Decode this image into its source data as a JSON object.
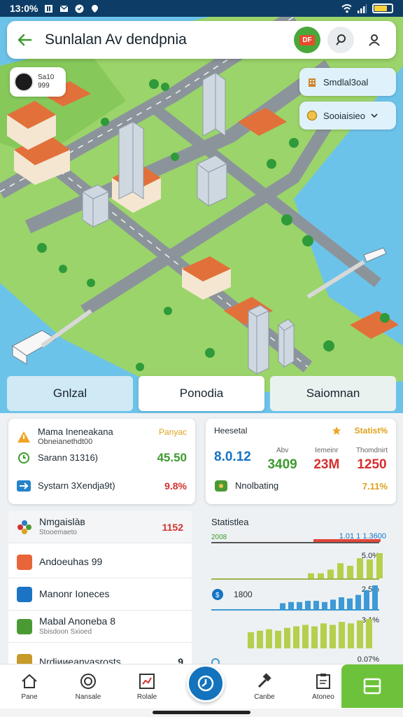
{
  "status_bar": {
    "time": "13:0%"
  },
  "header": {
    "title": "Sunlalan Av dendpnia",
    "flag_badge": "DF"
  },
  "player": {
    "line1": "Sa10",
    "line2": "999"
  },
  "side_pills": [
    {
      "label": "Smdlal3oal"
    },
    {
      "label": "Sooiaisieo"
    }
  ],
  "tabs": [
    {
      "label": "Gnlzal"
    },
    {
      "label": "Ponodia"
    },
    {
      "label": "Saiomnan"
    }
  ],
  "card_a": {
    "rows": [
      {
        "label": "Mama Ineneakana",
        "sub": "Obneianethdt00",
        "value": "Panyac",
        "value_color": "#e0a11b"
      },
      {
        "label": "Sarann 31316)",
        "sub": "",
        "value": "45.50",
        "value_color": "#3d9a2e"
      },
      {
        "label": "Systarn 3Xendja9t)",
        "sub": "",
        "value": "9.8%",
        "value_color": "#d62f2f"
      }
    ]
  },
  "card_b": {
    "head_left": "Heesetal",
    "head_right": "Statist%",
    "cols": [
      {
        "label": "",
        "value": "8.0.12",
        "color": "#1474c4"
      },
      {
        "label": "Abv",
        "value": "3409",
        "color": "#3d9a2e"
      },
      {
        "label": "Iemeinr",
        "value": "23M",
        "color": "#d62f2f"
      },
      {
        "label": "Thomdnirt",
        "value": "1250",
        "color": "#d62f2f"
      }
    ],
    "footer_label": "Nnolbating",
    "footer_value": "7.11%"
  },
  "list": [
    {
      "title": "Nmgaislàв",
      "sub": "Stooemaeto",
      "value": "1152",
      "value_color": "#d62f2f",
      "icon_color": "#2f7bc4"
    },
    {
      "title": "Andoeuhas 99",
      "sub": "",
      "value": "",
      "value_color": "#333",
      "icon_color": "#e8653a"
    },
    {
      "title": "Manonr Ioneces",
      "sub": "",
      "value": "",
      "value_color": "#333",
      "icon_color": "#1b74c4"
    },
    {
      "title": "Mabal Anoneba 8",
      "sub": "Sbisdoon Sxioed",
      "value": "",
      "value_color": "#333",
      "icon_color": "#4a9a34"
    },
    {
      "title": "Nrdiииeanvasrosts",
      "sub": "",
      "value": "9",
      "value_color": "#333",
      "icon_color": "#c79a2a"
    }
  ],
  "stats_chart": {
    "title": "Statistlea",
    "top_left_label": "2008",
    "top_right_label": "1.01 1 1.3600",
    "rows": [
      {
        "label": "",
        "percent_label": "5.0%",
        "color": "#b6cf4c"
      },
      {
        "label": "1800",
        "percent_label": "2.5%",
        "color": "#3d9ad6"
      },
      {
        "label": "",
        "percent_label": "3.1%",
        "color": "#b6cf4c"
      },
      {
        "label": "",
        "percent_label": "0.07%",
        "color": "#b6cf4c"
      }
    ]
  },
  "chart_data": [
    {
      "type": "bar",
      "series": [
        {
          "name": "",
          "values": [
            0.2,
            0.2,
            0.35,
            0.6,
            0.5,
            0.8,
            0.75,
            1.0
          ]
        }
      ]
    },
    {
      "type": "bar",
      "series": [
        {
          "name": "",
          "values": [
            0.25,
            0.3,
            0.3,
            0.35,
            0.35,
            0.3,
            0.4,
            0.5,
            0.45,
            0.6,
            0.8,
            1.0
          ]
        }
      ]
    },
    {
      "type": "bar",
      "series": [
        {
          "name": "",
          "values": [
            0.55,
            0.6,
            0.65,
            0.6,
            0.7,
            0.75,
            0.8,
            0.75,
            0.85,
            0.8,
            0.9,
            0.85,
            0.95,
            1.0
          ]
        }
      ]
    }
  ],
  "bottom_nav": [
    {
      "label": "Pane"
    },
    {
      "label": "Nansale"
    },
    {
      "label": "Rolale"
    },
    {
      "label": ""
    },
    {
      "label": "Canbe"
    },
    {
      "label": "Atoneo"
    }
  ]
}
